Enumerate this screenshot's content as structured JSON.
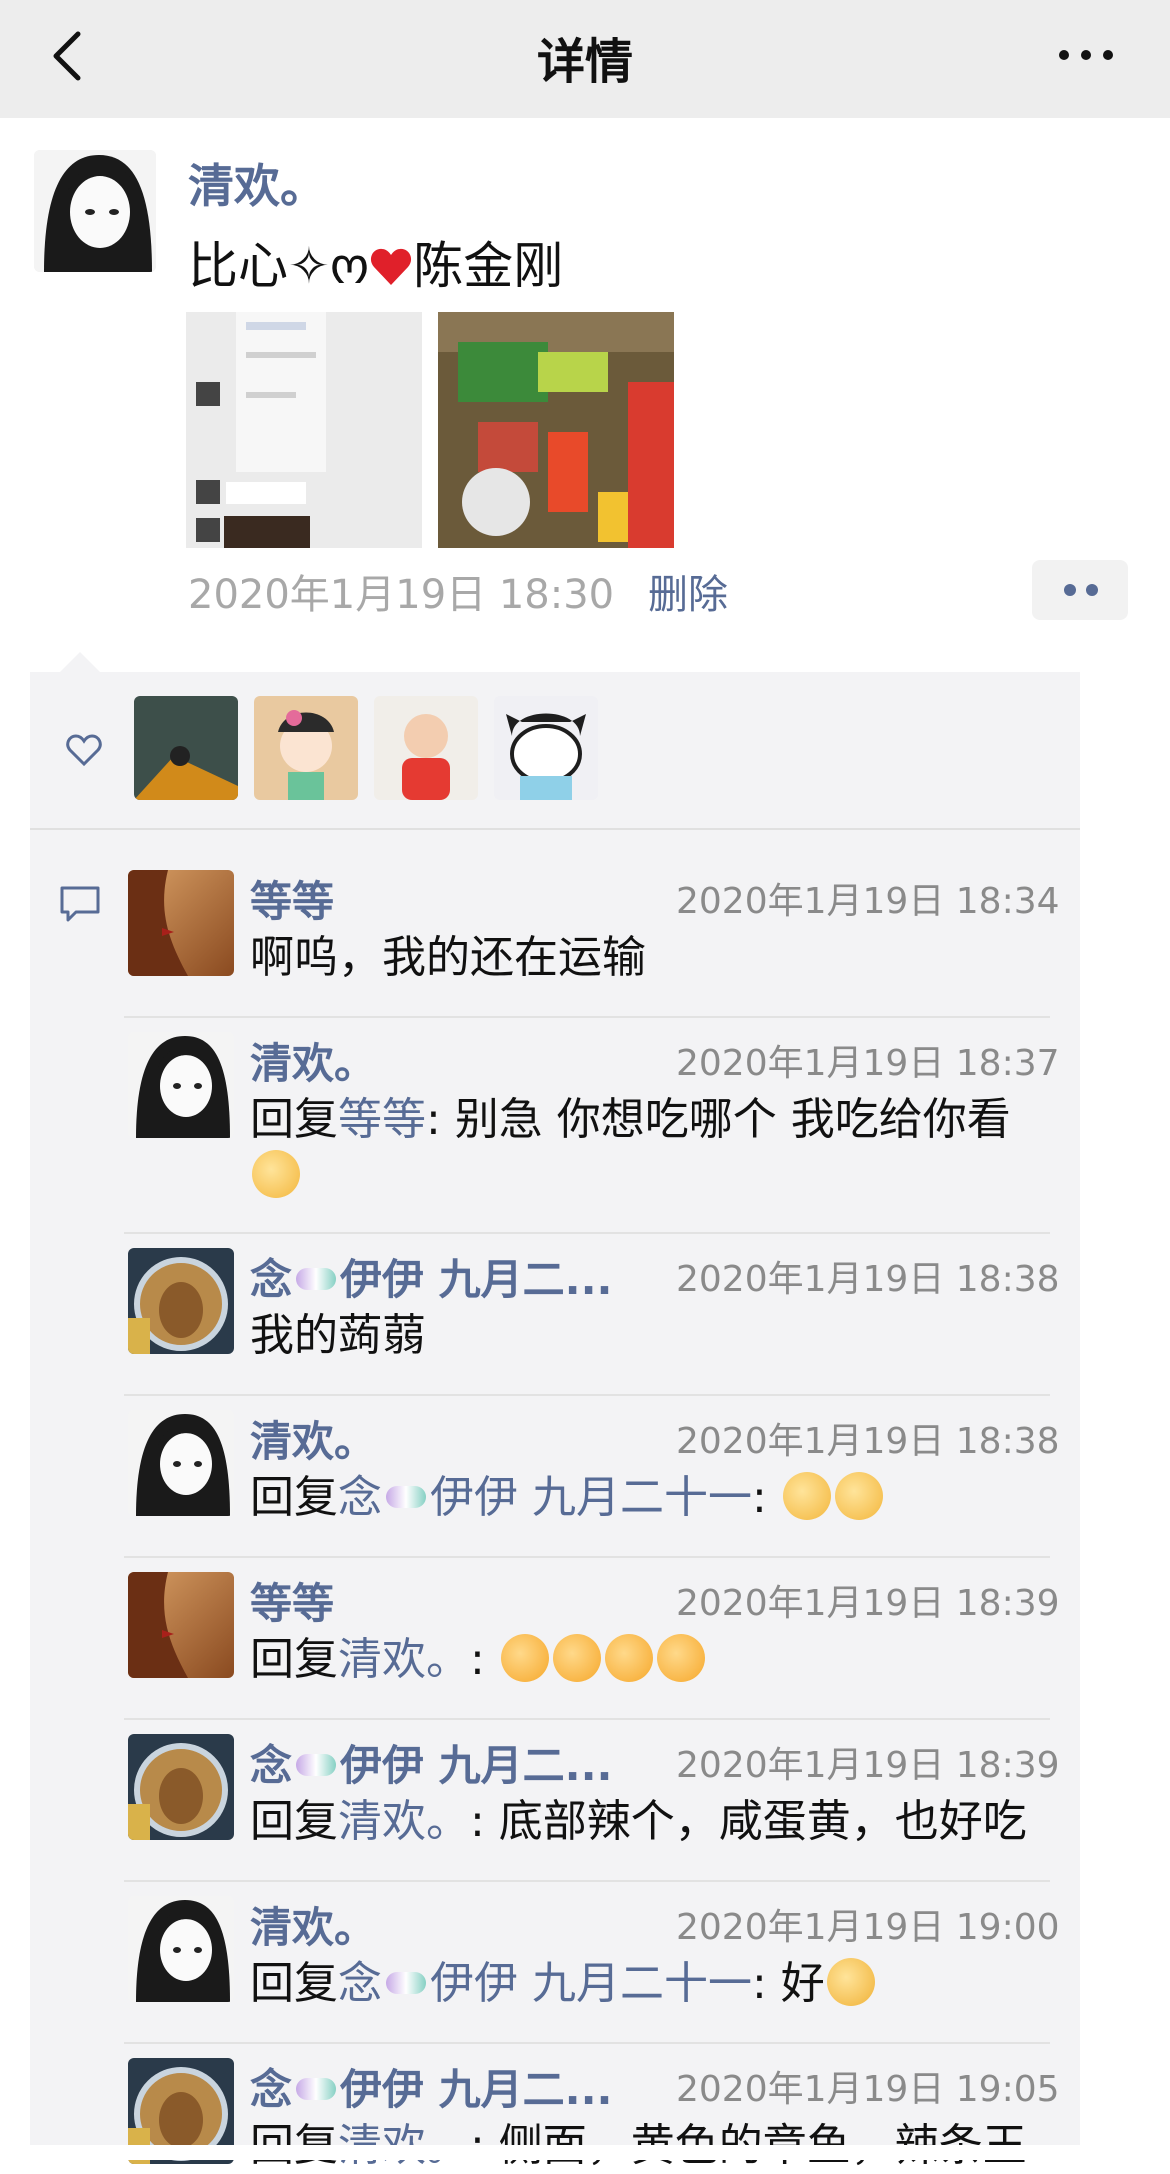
{
  "nav": {
    "title": "详情",
    "back_icon": "chevron-left-icon",
    "more_icon": "ellipsis-icon"
  },
  "post": {
    "author": "清欢。",
    "text_prefix": "比心✧ო",
    "text_suffix": "陈金刚",
    "time": "2020年1月19日 18:30",
    "delete_label": "删除"
  },
  "comments": [
    {
      "name": "等等",
      "time": "2020年1月19日 18:34",
      "text": "啊呜，我的还在运输"
    },
    {
      "name": "清欢。",
      "time": "2020年1月19日 18:37",
      "reply_label": "回复",
      "reply_to": "等等",
      "text": ": 别急 你想吃哪个 我吃给你看"
    },
    {
      "name_prefix": "念",
      "name_suffix": "伊伊 九月二...",
      "time": "2020年1月19日 18:38",
      "text": "我的蒟蒻"
    },
    {
      "name": "清欢。",
      "time": "2020年1月19日 18:38",
      "reply_label": "回复",
      "reply_to_prefix": "念",
      "reply_to_suffix": "伊伊 九月二十一",
      "text": ":"
    },
    {
      "name": "等等",
      "time": "2020年1月19日 18:39",
      "reply_label": "回复",
      "reply_to": "清欢。",
      "text": ":"
    },
    {
      "name_prefix": "念",
      "name_suffix": "伊伊 九月二...",
      "time": "2020年1月19日 18:39",
      "reply_label": "回复",
      "reply_to": "清欢。",
      "text": ": 底部辣个，咸蛋黄，也好吃"
    },
    {
      "name": "清欢。",
      "time": "2020年1月19日 19:00",
      "reply_label": "回复",
      "reply_to_prefix": "念",
      "reply_to_suffix": "伊伊 九月二十一",
      "text": ": 好"
    },
    {
      "name_prefix": "念",
      "name_suffix": "伊伊 九月二...",
      "time": "2020年1月19日 19:05",
      "reply_label": "回复",
      "reply_to": "清欢。",
      "text": ": 侧面，黄色的章鱼，辣条王"
    }
  ],
  "colors": {
    "link": "#576b95",
    "panel": "#f3f3f5",
    "nav": "#ededed"
  }
}
